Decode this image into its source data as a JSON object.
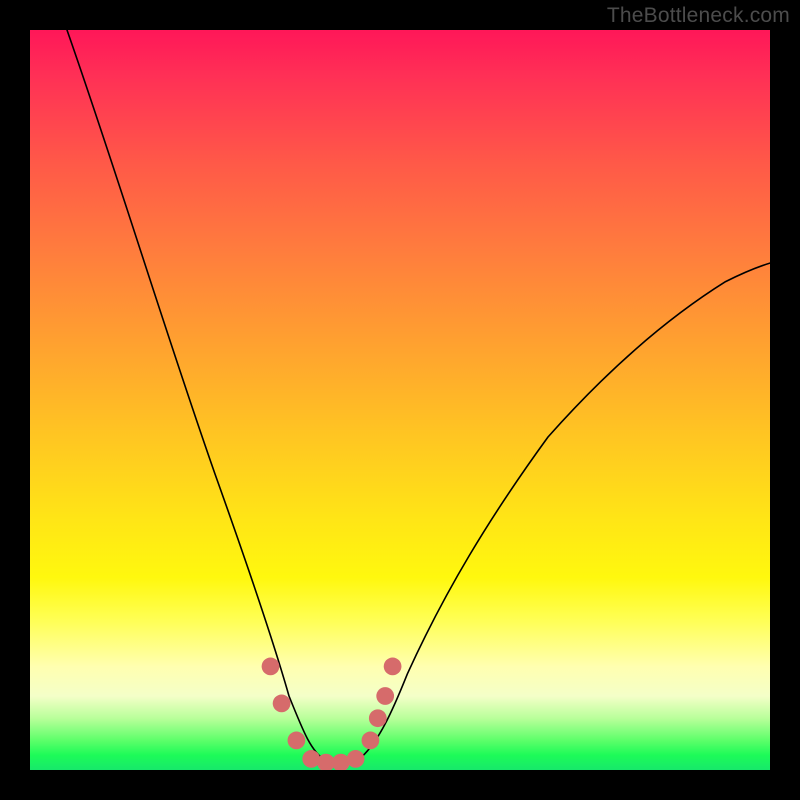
{
  "watermark": "TheBottleneck.com",
  "chart_data": {
    "type": "line",
    "title": "",
    "xlabel": "",
    "ylabel": "",
    "xlim": [
      0,
      100
    ],
    "ylim": [
      0,
      100
    ],
    "series": [
      {
        "name": "bottleneck-curve",
        "x": [
          5,
          10,
          15,
          20,
          25,
          30,
          33,
          35,
          37,
          40,
          43,
          46,
          50,
          55,
          60,
          65,
          70,
          75,
          80,
          85,
          90,
          95,
          100
        ],
        "values": [
          100,
          85,
          70,
          55,
          40,
          25,
          13,
          7,
          3,
          1,
          1,
          3,
          10,
          20,
          30,
          38,
          45,
          51,
          56,
          60,
          63,
          66,
          68
        ]
      }
    ],
    "markers": {
      "name": "highlight-dots",
      "color": "#d66b6b",
      "x": [
        32.5,
        34,
        36,
        38,
        40,
        42,
        44,
        46,
        47,
        48,
        49
      ],
      "values": [
        14,
        9,
        4,
        1.5,
        1,
        1,
        1.5,
        4,
        7,
        10,
        14
      ]
    },
    "grid": false,
    "legend": false
  }
}
